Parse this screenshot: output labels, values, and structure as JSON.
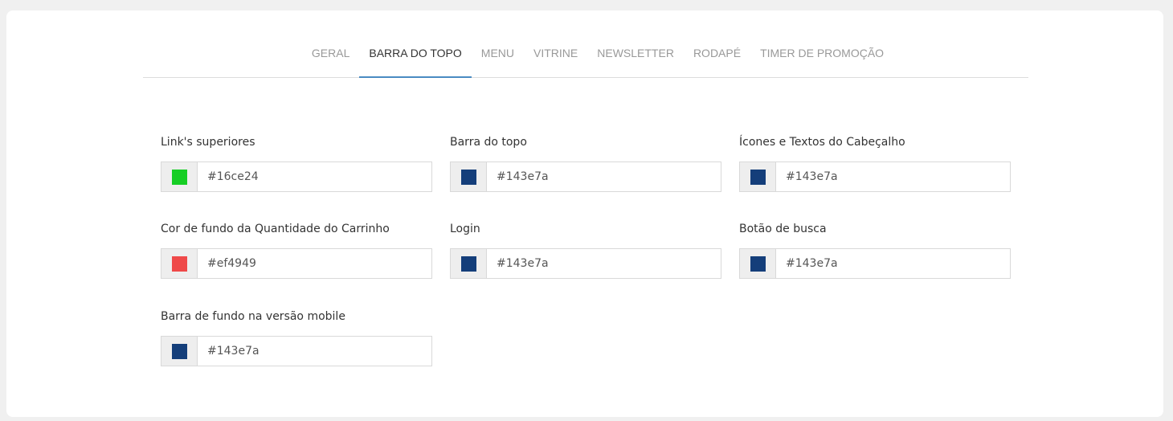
{
  "tabs": [
    {
      "label": "GERAL",
      "active": false
    },
    {
      "label": "BARRA DO TOPO",
      "active": true
    },
    {
      "label": "MENU",
      "active": false
    },
    {
      "label": "VITRINE",
      "active": false
    },
    {
      "label": "NEWSLETTER",
      "active": false
    },
    {
      "label": "RODAPÉ",
      "active": false
    },
    {
      "label": "TIMER DE PROMOÇÃO",
      "active": false
    }
  ],
  "fields": [
    {
      "label": "Link's superiores",
      "value": "#16ce24",
      "color": "#16ce24"
    },
    {
      "label": "Barra do topo",
      "value": "#143e7a",
      "color": "#143e7a"
    },
    {
      "label": "Ícones e Textos do Cabeçalho",
      "value": "#143e7a",
      "color": "#143e7a"
    },
    {
      "label": "Cor de fundo da Quantidade do Carrinho",
      "value": "#ef4949",
      "color": "#ef4949"
    },
    {
      "label": "Login",
      "value": "#143e7a",
      "color": "#143e7a"
    },
    {
      "label": "Botão de busca",
      "value": "#143e7a",
      "color": "#143e7a"
    },
    {
      "label": "Barra de fundo na versão mobile",
      "value": "#143e7a",
      "color": "#143e7a"
    }
  ]
}
